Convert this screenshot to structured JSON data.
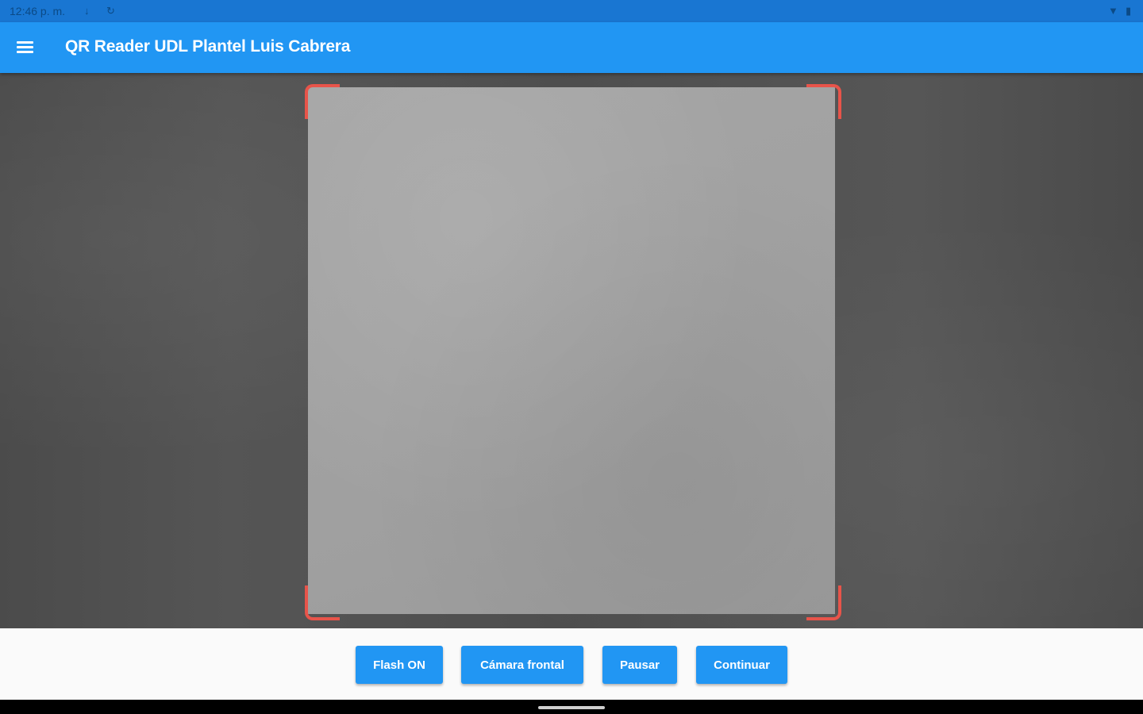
{
  "status_bar": {
    "time": "12:46 p. m.",
    "left_icons": [
      "download-icon",
      "sync-icon"
    ],
    "right_icons": [
      "wifi-icon",
      "battery-icon"
    ]
  },
  "app_bar": {
    "title": "QR Reader UDL Plantel Luis Cabrera",
    "menu_icon": "menu-icon"
  },
  "scanner": {
    "frame_color": "#e8544a"
  },
  "buttons": {
    "flash": "Flash ON",
    "camera": "Cámara frontal",
    "pause": "Pausar",
    "continue": "Continuar"
  },
  "colors": {
    "accent": "#2196f3",
    "status_bar": "#1976d2",
    "frame": "#e8544a"
  }
}
